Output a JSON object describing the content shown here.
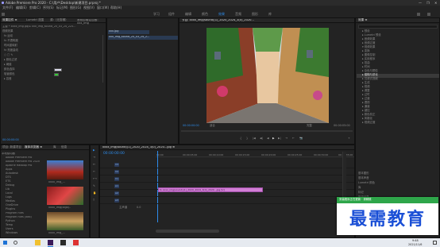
{
  "window": {
    "title": "Adobe Premiere Pro 2020 - C:\\用户\\Desktop\\新建项目.prproj *",
    "controls": [
      "—",
      "❐",
      "✕"
    ]
  },
  "menu": [
    "文件(F)",
    "编辑(E)",
    "剪辑(C)",
    "序列(S)",
    "标记(M)",
    "图形(G)",
    "视图(V)",
    "窗口(W)",
    "帮助(H)"
  ],
  "workspaces": {
    "items": [
      "学习",
      "组件",
      "编辑",
      "颜色",
      "效果",
      "音频",
      "图形",
      "库"
    ],
    "active_index": 4
  },
  "effect_controls": {
    "tabs": [
      "效果控件 ≡",
      "Lumetri 范围",
      "源:（无剪辑）",
      "音频剪辑混合器：xxx_img"
    ],
    "source_line": "主要 * xxxx_img.jpg  ▸  xxx_img_sound_20_03_24_225...",
    "section": "视频效果",
    "rows": [
      "fx 运动",
      "fx 不透明度",
      "时间重映射",
      "fx 亮度曲线",
      "  ○ □ ✎",
      "  ▸ 颜色过滤",
      "  ▸ 阈值",
      "  颜色选择",
      "  吸管颜色",
      "  ▸ 容差"
    ],
    "timecode": "00:00:00:00"
  },
  "clip_panel": {
    "items": [
      "xxx.jpg",
      "xxx_img_sound_20_03_24_2..."
    ]
  },
  "program": {
    "tab": "节目: xxxx_img(sound)(1)_2020_2024_3(0)_2020...",
    "timecode_left": "00:00:00:00",
    "fit": "适合",
    "quality": "完整",
    "timecode_right": "00:00:05:00",
    "buttons": [
      "{",
      "}",
      "|◀",
      "◀|",
      "◀",
      "▶",
      "▶|",
      "⇥",
      "⇤",
      "📷",
      "+"
    ]
  },
  "effects_panel": {
    "tab": "效果 ≡",
    "search_placeholder": "",
    "items": [
      "▸ 预设",
      "▸ Lumetri 预设",
      "▸ 音频效果",
      "▸ 音频过渡",
      "▾ 视频效果",
      "  ▸ 变换",
      "  ▸ 图像控制",
      "  ▸ 实用程序",
      "  ▸ 扭曲",
      "  ▸ 时间",
      "  ▸ 杂色与颗粒",
      "  ▸ 模糊与锐化",
      "  ▸ 沉浸式视频",
      "  ▸ 生成",
      "  ▸ 视频",
      "  ▸ 调整",
      "  ▸ 过时",
      "  ▸ 过渡",
      "  ▸ 透视",
      "  ▸ 通道",
      "  ▸ 键控",
      "  ▸ 颜色校正",
      "  ▸ 风格化",
      "▸ 视频过渡"
    ],
    "bottom": [
      "基本图形",
      "基本声音",
      "Lumetri 颜色",
      "库",
      "标记",
      "历史记录",
      "信息"
    ]
  },
  "project": {
    "tabs": [
      "项目: 新建项目",
      "媒体浏览器 ≡",
      "库",
      "信息"
    ],
    "folders": [
      "本地驱动器",
      "Adobe Premiere Pro",
      "Adobe Premiere Pro 2020",
      "Apache Hadoop Pro",
      "Apps",
      "Autodesk",
      "DTS",
      "ETS",
      "Debug",
      "Lib",
      "Local",
      "Logs",
      "Medias",
      "OneDrive",
      "PlugIns",
      "Program Files",
      "Program Files (x86)",
      "Python",
      "Temp",
      "Users",
      "Windows",
      "Xsi",
      "下载",
      "视频",
      "图片",
      "桌面"
    ],
    "thumb_labels": [
      "xxxx_img_...",
      "xxxx_img(logo)..",
      "xxxx_img_...",
      ""
    ]
  },
  "timeline": {
    "tab": "xxxx_img(sound)(1)_2020_2024_3(0)_2020...jpg ≡",
    "timecode": "00:00:00:00",
    "ruler": [
      "00:00",
      "00:00:05:00",
      "00:00:10:00",
      "00:00:15:00",
      "00:00:20:00",
      "00:00:25:00",
      "00:00:30:00",
      "00:00:35:00"
    ],
    "tracks": [
      "V3",
      "V2",
      "V1",
      "A1",
      "A2",
      "A3",
      "主声道"
    ],
    "clip_label": "fx xxxx_img(sound)(1)_2020_2024_3(0)_2020...jpg [V]",
    "master_value": "0.0"
  },
  "tools": [
    "▶",
    "⇥",
    "↔",
    "✂",
    "⟷",
    "✎",
    "✋",
    "T"
  ],
  "overlay": {
    "heading": "安装程序正在更新 · 请稍候",
    "watermark": "最需教育"
  },
  "taskbar": {
    "time": "9:48",
    "date": "2021/11/6"
  }
}
